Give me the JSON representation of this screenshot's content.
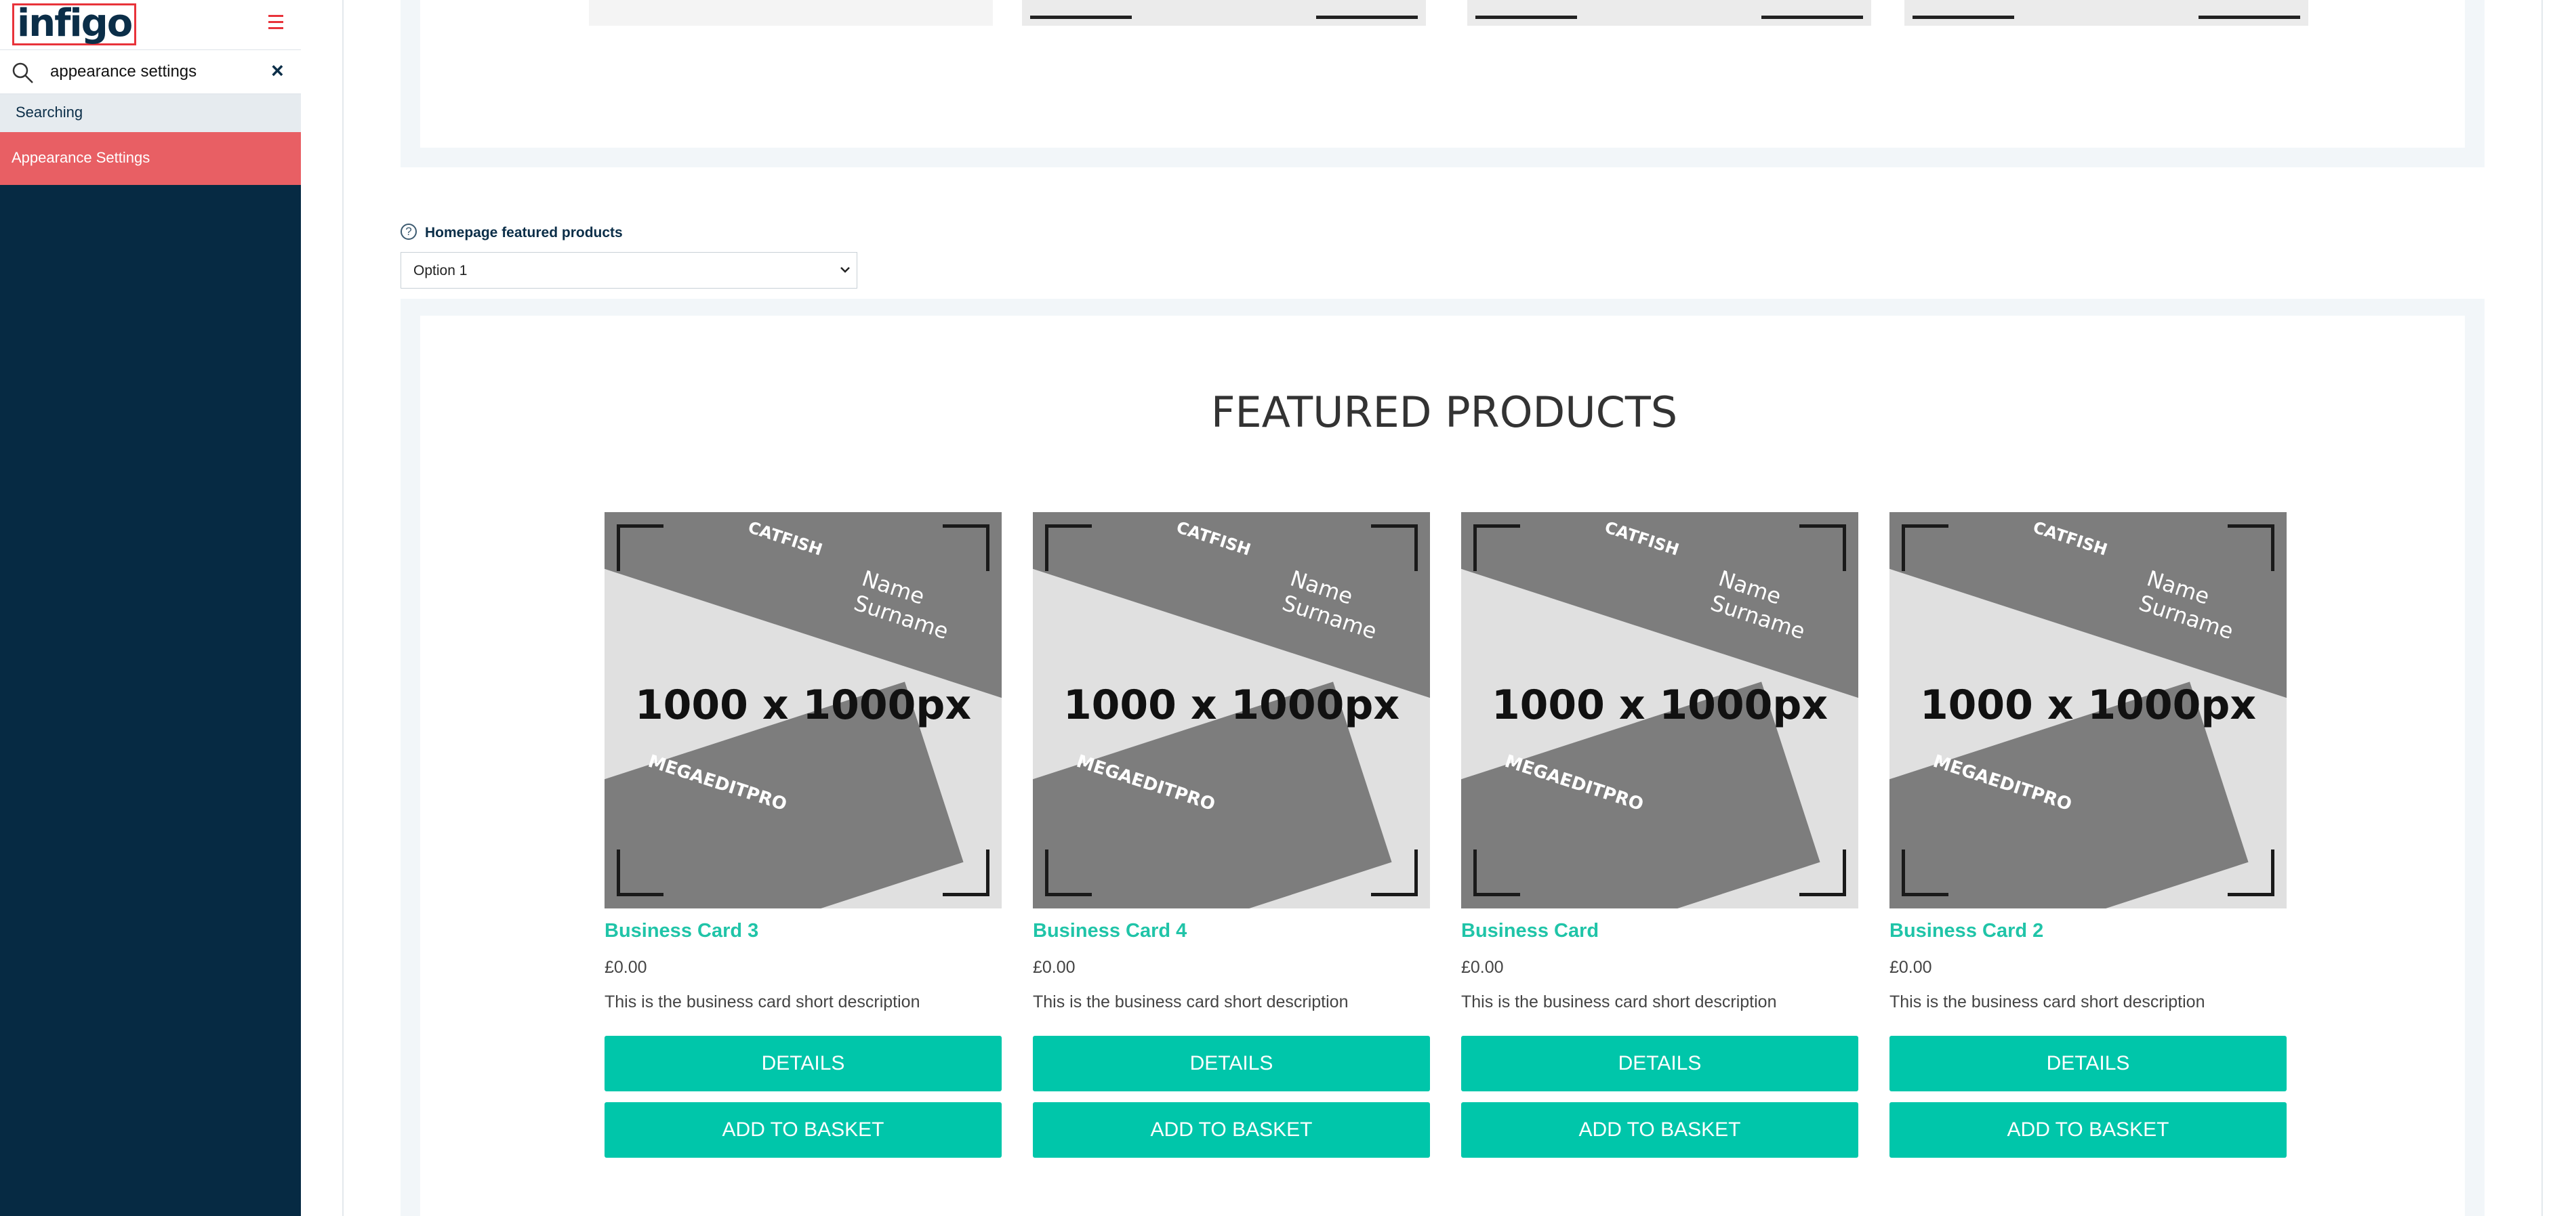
{
  "sidebar": {
    "logo_text": "infigo",
    "search": {
      "value": "appearance settings"
    },
    "status": "Searching",
    "results": [
      {
        "label": "Appearance Settings"
      }
    ]
  },
  "settings": {
    "featured_label": "Homepage featured products",
    "featured_select": {
      "selected": "Option 1"
    }
  },
  "preview": {
    "title": "FEATURED PRODUCTS",
    "image_placeholder": "1000 x 1000px",
    "image_brand_top": "CATFISH",
    "image_brand_bottom": "MEGAEDITPRO",
    "image_name": "Name Surname",
    "products": [
      {
        "name": "Business Card 3",
        "price": "£0.00",
        "description": "This is the business card short description",
        "details_label": "DETAILS",
        "basket_label": "ADD TO BASKET"
      },
      {
        "name": "Business Card 4",
        "price": "£0.00",
        "description": "This is the business card short description",
        "details_label": "DETAILS",
        "basket_label": "ADD TO BASKET"
      },
      {
        "name": "Business Card",
        "price": "£0.00",
        "description": "This is the business card short description",
        "details_label": "DETAILS",
        "basket_label": "ADD TO BASKET"
      },
      {
        "name": "Business Card 2",
        "price": "£0.00",
        "description": "This is the business card short description",
        "details_label": "DETAILS",
        "basket_label": "ADD TO BASKET"
      }
    ]
  },
  "colors": {
    "sidebar_bg": "#062a43",
    "accent": "#00c6aa",
    "highlight": "#e85f64",
    "logo_border": "#e8333a"
  },
  "icons": {
    "search": "search-icon",
    "clear": "close-icon",
    "menu": "hamburger-icon",
    "help": "help-icon",
    "select": "chevron-down-icon"
  }
}
